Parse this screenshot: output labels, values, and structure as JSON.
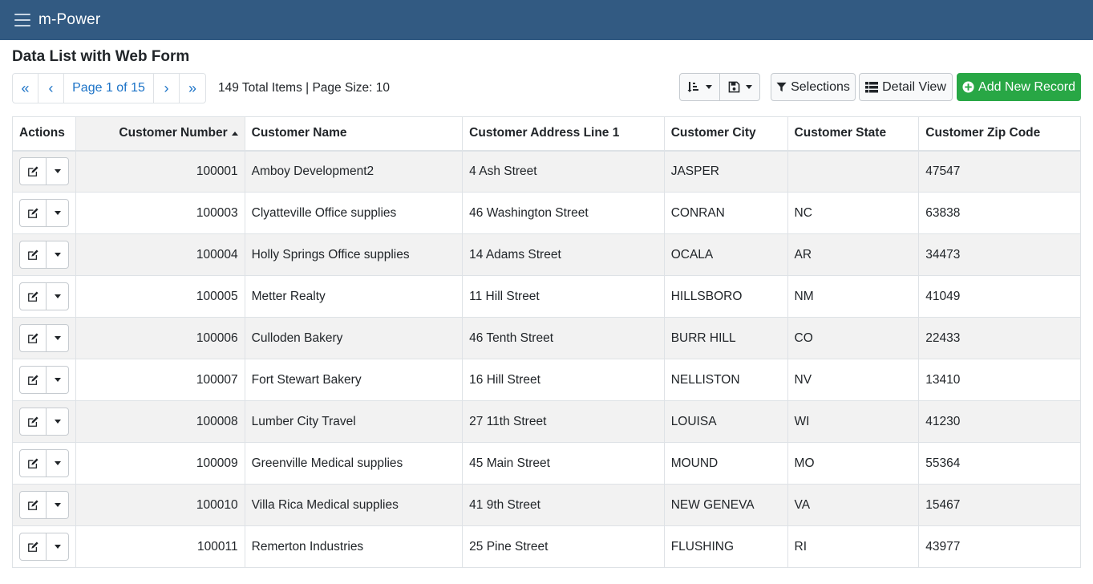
{
  "app": {
    "brand": "m-Power"
  },
  "page": {
    "title": "Data List with Web Form"
  },
  "pager": {
    "first": "«",
    "prev": "‹",
    "label": "Page 1 of 15",
    "next": "›",
    "last": "»",
    "summary": "149 Total Items | Page Size: 10"
  },
  "toolbar": {
    "selections": "Selections",
    "detail_view": "Detail View",
    "add_new": "Add New Record"
  },
  "icons": {
    "sort": "sort-amount-icon",
    "save": "floppy-disk-icon",
    "filter": "filter-icon",
    "list": "list-icon",
    "add": "plus-circle-icon",
    "edit": "edit-icon",
    "menu": "hamburger-icon"
  },
  "colors": {
    "navbar": "#325a82",
    "link": "#1c73c7",
    "success": "#28a745"
  },
  "table": {
    "headers": [
      "Actions",
      "Customer Number",
      "Customer Name",
      "Customer Address Line 1",
      "Customer City",
      "Customer State",
      "Customer Zip Code"
    ],
    "rows": [
      [
        "100001",
        "Amboy Development2",
        "4 Ash Street",
        "JASPER",
        "",
        "47547"
      ],
      [
        "100003",
        "Clyatteville Office supplies",
        "46 Washington Street",
        "CONRAN",
        "NC",
        "63838"
      ],
      [
        "100004",
        "Holly Springs Office supplies",
        "14 Adams Street",
        "OCALA",
        "AR",
        "34473"
      ],
      [
        "100005",
        "Metter Realty",
        "11 Hill Street",
        "HILLSBORO",
        "NM",
        "41049"
      ],
      [
        "100006",
        "Culloden Bakery",
        "46 Tenth Street",
        "BURR HILL",
        "CO",
        "22433"
      ],
      [
        "100007",
        "Fort Stewart Bakery",
        "16 Hill Street",
        "NELLISTON",
        "NV",
        "13410"
      ],
      [
        "100008",
        "Lumber City Travel",
        "27 11th Street",
        "LOUISA",
        "WI",
        "41230"
      ],
      [
        "100009",
        "Greenville Medical supplies",
        "45 Main Street",
        "MOUND",
        "MO",
        "55364"
      ],
      [
        "100010",
        "Villa Rica Medical supplies",
        "41 9th Street",
        "NEW GENEVA",
        "VA",
        "15467"
      ],
      [
        "100011",
        "Remerton Industries",
        "25 Pine Street",
        "FLUSHING",
        "RI",
        "43977"
      ]
    ]
  }
}
